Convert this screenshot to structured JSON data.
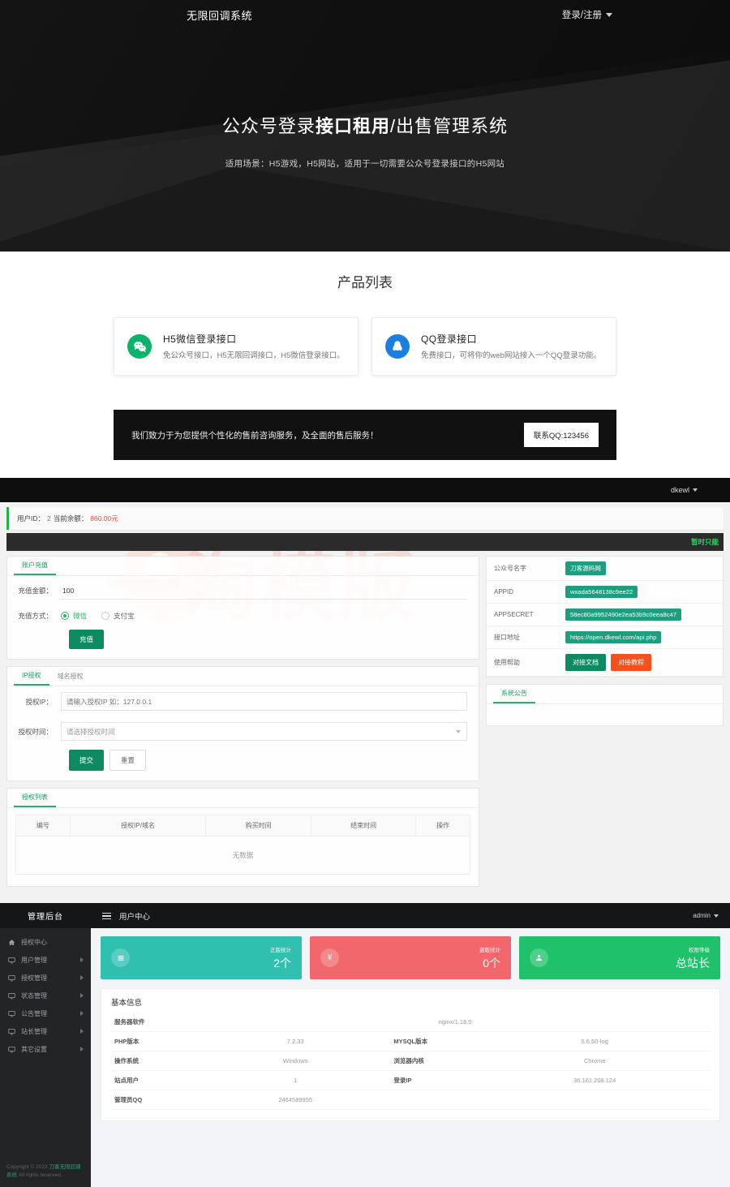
{
  "site": {
    "nav": {
      "brand": "无限回调系统",
      "login_label": "登录/注册"
    },
    "hero": {
      "title_pre": "公众号登录",
      "title_bold": "接口租用",
      "title_post": "/出售管理系统",
      "subtitle": "适用场景：H5游戏，H5网站，适用于一切需要公众号登录接口的H5网站"
    },
    "products": {
      "heading": "产品列表",
      "items": [
        {
          "icon": "wechat-icon",
          "title": "H5微信登录接口",
          "desc": "免公众号接口，H5无限回调接口，H5微信登录接口。"
        },
        {
          "icon": "qq-icon",
          "title": "QQ登录接口",
          "desc": "免费接口，可将你的web网站接入一个QQ登录功能。"
        }
      ]
    },
    "cta": {
      "text": "我们致力于为您提供个性化的售前咨询服务，及全面的售后服务！",
      "button": "联系QQ:123456"
    }
  },
  "usercenter": {
    "topbar": {
      "user": "dkewl"
    },
    "alert": {
      "label_id": "用户ID：",
      "user_id": "2",
      "label_balance": "当前余额：",
      "balance": "860.00元"
    },
    "notice": {
      "text": "暂时只能"
    },
    "recharge": {
      "tab": "账户充值",
      "amount_label": "充值金额：",
      "amount_value": "100",
      "method_label": "充值方式：",
      "methods": [
        {
          "label": "微信",
          "selected": true
        },
        {
          "label": "支付宝",
          "selected": false
        }
      ],
      "submit": "充值"
    },
    "auth": {
      "tabs": [
        {
          "label": "IP授权",
          "active": true
        },
        {
          "label": "域名授权",
          "active": false
        }
      ],
      "ip_label": "授权IP：",
      "ip_placeholder": "请输入授权IP 如：127.0.0.1",
      "time_label": "授权时间：",
      "time_placeholder": "请选择授权时间",
      "submit": "提交",
      "reset": "重置"
    },
    "authlist": {
      "tab": "授权列表",
      "columns": [
        "编号",
        "授权IP/域名",
        "购买时间",
        "结束时间",
        "操作"
      ],
      "empty_text": "无数据"
    },
    "account_info": {
      "rows": [
        {
          "key": "公众号名字",
          "value": "刀客源码网",
          "type": "badge"
        },
        {
          "key": "APPID",
          "value": "wxada5648138c9ee22",
          "type": "badge"
        },
        {
          "key": "APPSECRET",
          "value": "58ec80a9952490e2ea53b9c0eea8c47",
          "type": "badge"
        },
        {
          "key": "接口地址",
          "value": "https://open.dkewl.com/api.php",
          "type": "badge"
        }
      ],
      "help_label": "使用帮助",
      "help_buttons": [
        {
          "label": "对接文档",
          "color": "#0e8a63"
        },
        {
          "label": "对接教程",
          "color": "#f4511e"
        }
      ]
    },
    "announcement": {
      "tab": "系统公告"
    }
  },
  "admin": {
    "logo": "管理后台",
    "header": {
      "title": "用户中心",
      "user": "admin"
    },
    "sidebar": [
      {
        "label": "授权中心",
        "icon": "home-icon",
        "has_children": false
      },
      {
        "label": "用户管理",
        "icon": "monitor-icon",
        "has_children": true
      },
      {
        "label": "授权管理",
        "icon": "monitor-icon",
        "has_children": true
      },
      {
        "label": "状态管理",
        "icon": "monitor-icon",
        "has_children": true
      },
      {
        "label": "公告管理",
        "icon": "monitor-icon",
        "has_children": true
      },
      {
        "label": "站长管理",
        "icon": "monitor-icon",
        "has_children": true
      },
      {
        "label": "其它设置",
        "icon": "monitor-icon",
        "has_children": true
      }
    ],
    "copyright": {
      "pre": "Copyright © 2022 ",
      "brand": "刀客无限回调系统",
      "post": " All rights reserved."
    },
    "stats": [
      {
        "icon": "list-icon",
        "label": "正版统计",
        "value": "2个",
        "color": "#2fc0b0"
      },
      {
        "icon": "yen-icon",
        "label": "盗版统计",
        "value": "0个",
        "color": "#f2676b"
      },
      {
        "icon": "user-icon",
        "label": "权限等级",
        "value": "总站长",
        "color": "#1fc16b"
      }
    ],
    "basic_info": {
      "heading": "基本信息",
      "rows": [
        {
          "k1": "服务器软件",
          "v1": "",
          "k2": "",
          "v2": "nginx/1.18.0",
          "wide": true
        },
        {
          "k1": "PHP版本",
          "v1": "7.2.33",
          "k2": "MYSQL版本",
          "v2": "5.6.50-log"
        },
        {
          "k1": "操作系统",
          "v1": "Windows",
          "k2": "浏览器内核",
          "v2": "Chrome"
        },
        {
          "k1": "站点用户",
          "v1": "1",
          "k2": "登录IP",
          "v2": "36.161.208.124"
        },
        {
          "k1": "管理员QQ",
          "v1": "2464589955",
          "k2": "",
          "v2": ""
        }
      ]
    }
  }
}
